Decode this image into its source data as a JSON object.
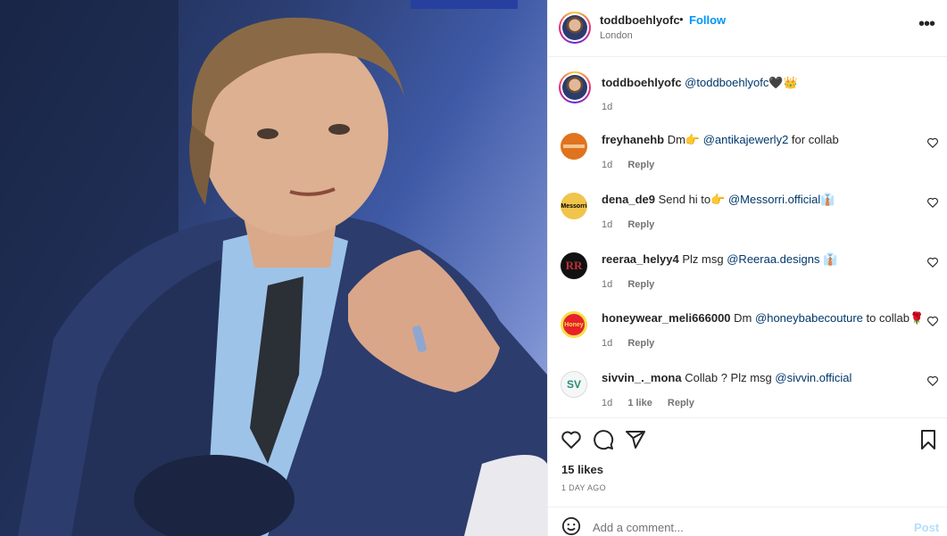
{
  "post": {
    "username": "toddboehlyofc",
    "separator": "•",
    "follow_label": "Follow",
    "location": "London",
    "more_label": "•••"
  },
  "caption": {
    "username": "toddboehlyofc",
    "mention": "@toddboehlyofc",
    "emoji": "🖤👑",
    "time": "1d"
  },
  "comments": [
    {
      "username": "freyhanehb",
      "text_before": "Dm👉",
      "mention": "@antikajewerly2",
      "text_after": " for collab",
      "time": "1d",
      "likes": "",
      "reply": "Reply",
      "avatar_bg": "#e0731e",
      "avatar_label": ""
    },
    {
      "username": "dena_de9",
      "text_before": "Send hi to👉",
      "mention": "@Messorri.official",
      "text_after": "👔",
      "time": "1d",
      "likes": "",
      "reply": "Reply",
      "avatar_bg": "#f1c44b",
      "avatar_label": "Messorri"
    },
    {
      "username": "reeraa_helyy4",
      "text_before": "Plz msg",
      "mention": "@Reeraa.designs",
      "text_after": " 👔",
      "time": "1d",
      "likes": "",
      "reply": "Reply",
      "avatar_bg": "#111111",
      "avatar_label": "RR"
    },
    {
      "username": "honeywear_meli666000",
      "text_before": "Dm",
      "mention": "@honeybabecouture",
      "text_after": " to collab🌹",
      "time": "1d",
      "likes": "",
      "reply": "Reply",
      "avatar_bg": "#e8202a",
      "avatar_label": "Honey"
    },
    {
      "username": "sivvin_._mona",
      "text_before": "Collab ? Plz msg",
      "mention": "@sivvin.official",
      "text_after": "",
      "time": "1d",
      "likes": "1 like",
      "reply": "Reply",
      "avatar_bg": "#f4f7f6",
      "avatar_label": "SV"
    }
  ],
  "actions": {
    "likes": "15 likes",
    "time": "1 DAY AGO"
  },
  "comment_box": {
    "placeholder": "Add a comment...",
    "post_label": "Post"
  },
  "colors": {
    "follow": "#0095f6",
    "mention": "#00376b",
    "muted": "#737373"
  }
}
